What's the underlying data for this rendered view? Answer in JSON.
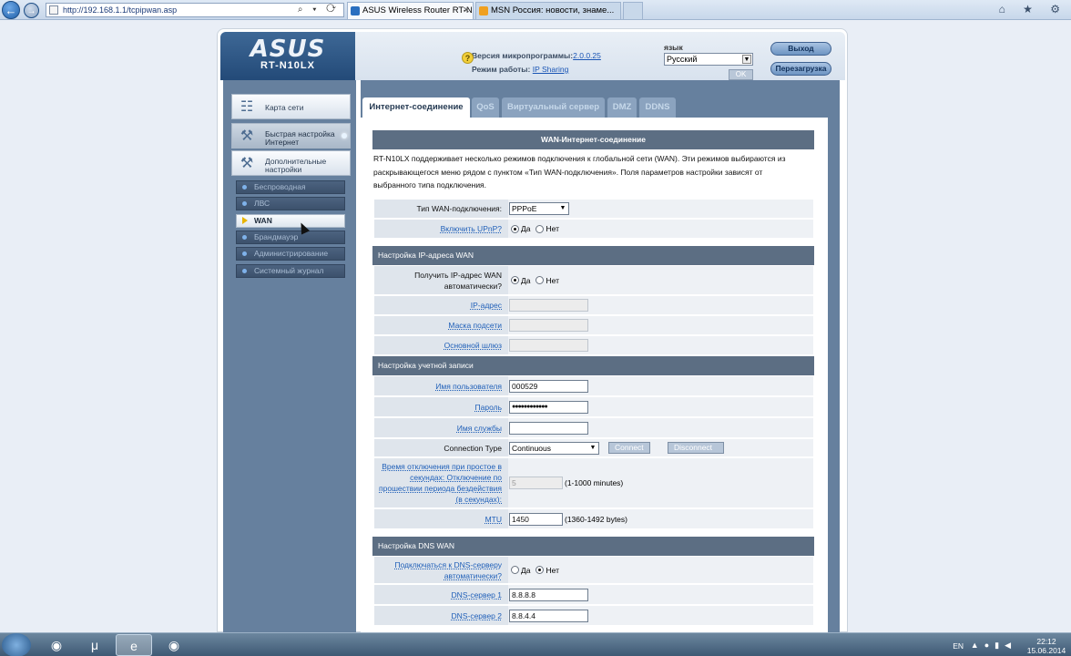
{
  "browser": {
    "address": "http://192.168.1.1/tcpipwan.asp",
    "address_controls": "⌕ ▾ ⟳",
    "tabs": [
      {
        "label": "ASUS Wireless Router RT-N..."
      },
      {
        "label": "MSN Россия: новости, знаме..."
      }
    ],
    "tab_close": "✕",
    "right_icons": "⌂ ★ ⚙"
  },
  "header": {
    "brand": "ASUS",
    "model": "RT-N10LX",
    "firmware_label": "Версия микропрограммы:",
    "firmware_value": "2.0.0.25",
    "mode_label": "Режим работы:",
    "mode_value": "IP Sharing",
    "lang_label": "язык",
    "lang_value": "Русский",
    "ok_label": "OK",
    "exit_label": "Выход",
    "reboot_label": "Перезагрузка"
  },
  "sidebar": {
    "big": [
      {
        "label": "Карта сети"
      },
      {
        "label": "Быстрая настройка Интернет"
      },
      {
        "label": "Дополнительные настройки"
      }
    ],
    "sub": [
      {
        "label": "Беспроводная"
      },
      {
        "label": "ЛВС"
      },
      {
        "label": "WAN"
      },
      {
        "label": "Брандмауэр"
      },
      {
        "label": "Администрирование"
      },
      {
        "label": "Системный журнал"
      }
    ]
  },
  "content": {
    "tabs": [
      {
        "label": "Интернет-соединение"
      },
      {
        "label": "QoS"
      },
      {
        "label": "Виртуальный сервер"
      },
      {
        "label": "DMZ"
      },
      {
        "label": "DDNS"
      }
    ],
    "help": "?",
    "title": "WAN-Интернет-соединение",
    "intro": "RT-N10LX поддерживает несколько режимов подключения к глобальной сети (WAN). Эти режимов выбираются из раскрывающегося меню рядом с пунктом «Тип WAN-подключения». Поля параметров настройки зависят от выбранного типа подключения.",
    "wan_type_label": "Тип WAN-подключения:",
    "wan_type_value": "PPPoE",
    "upnp_label": "Включить UPnP?",
    "yes": "Да",
    "no": "Нет",
    "ip_section": "Настройка IP-адреса WAN",
    "auto_ip_label": "Получить IP-адрес WAN автоматически?",
    "ip_label": "IP-адрес",
    "mask_label": "Маска подсети",
    "gateway_label": "Основной шлюз",
    "account_section": "Настройка учетной записи",
    "user_label": "Имя пользователя",
    "user_value": "000529",
    "pass_label": "Пароль",
    "pass_value": "●●●●●●●●●●●●",
    "service_label": "Имя службы",
    "conn_type_label": "Connection Type",
    "conn_type_value": "Continuous",
    "connect_label": "Connect",
    "disconnect_label": "Disconnect",
    "idle_label": "Время отключения при простое в секундах: Отключение по прошествии периода бездействия (в секундах):",
    "idle_value": "5",
    "idle_hint": "(1-1000 minutes)",
    "mtu_label": "MTU",
    "mtu_value": "1450",
    "mtu_hint": "(1360-1492 bytes)",
    "dns_section": "Настройка DNS WAN",
    "dns_auto_label": "Подключаться к DNS-серверу автоматически?",
    "dns1_label": "DNS-сервер 1",
    "dns1_value": "8.8.8.8",
    "dns2_label": "DNS-сервер 2",
    "dns2_value": "8.8.4.4"
  },
  "taskbar": {
    "lang": "EN",
    "time": "22:12",
    "date": "15.06.2014"
  }
}
